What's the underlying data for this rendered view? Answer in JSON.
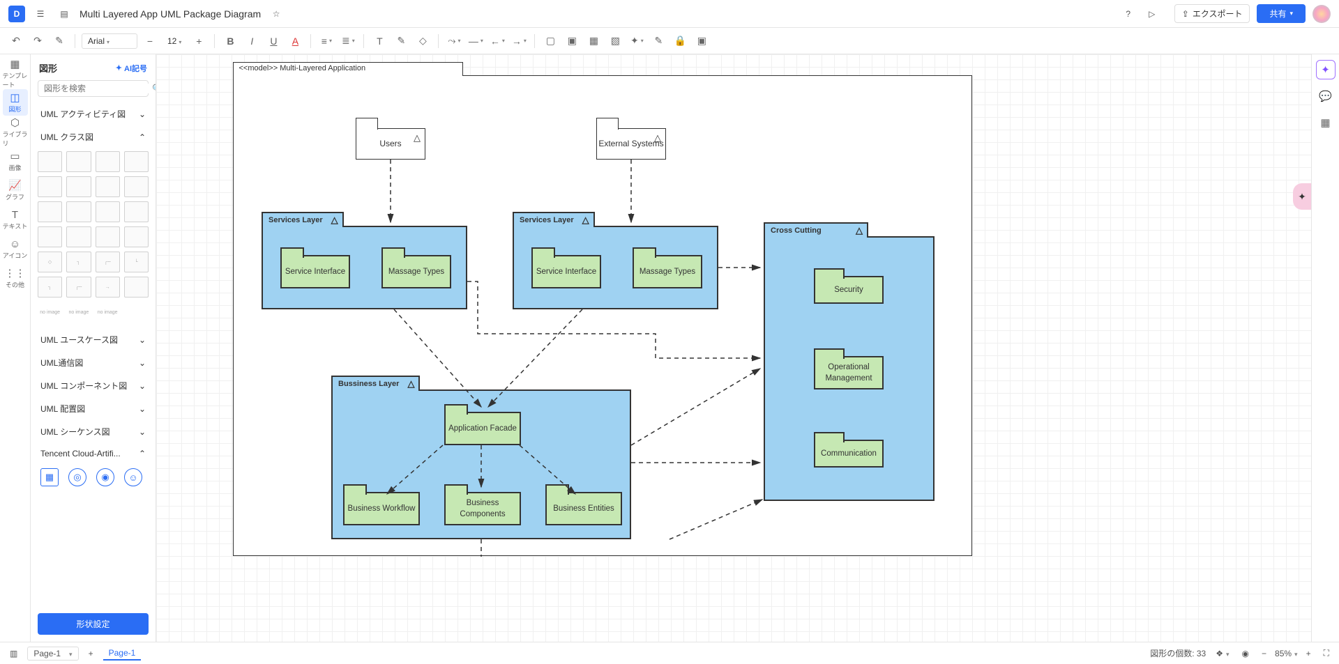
{
  "header": {
    "title": "Multi Layered App UML Package Diagram",
    "export": "エクスポート",
    "share": "共有"
  },
  "toolbar": {
    "font": "Arial",
    "fontSize": "12"
  },
  "leftRail": {
    "template": "テンプレート",
    "shapes": "図形",
    "library": "ライブラリ",
    "image": "画像",
    "graph": "グラフ",
    "text": "テキスト",
    "icon": "アイコン",
    "other": "その他"
  },
  "shapesPanel": {
    "title": "図形",
    "ai": "AI記号",
    "searchPlaceholder": "図形を検索",
    "cat_activity": "UML アクティビティ図",
    "cat_class": "UML クラス図",
    "cat_usecase": "UML ユースケース図",
    "cat_comm": "UML通信図",
    "cat_component": "UML コンポーネント図",
    "cat_deploy": "UML 配置図",
    "cat_sequence": "UML シーケンス図",
    "cat_tencent": "Tencent Cloud-Artifi...",
    "noImage": "no image",
    "shapeSettings": "形状設定"
  },
  "diagram": {
    "modelLabel": "<<model>> Multi-Layered Application",
    "users": "Users",
    "external": "External Systems",
    "servicesLayer": "Services Layer",
    "serviceInterface": "Service Interface",
    "massageTypes": "Massage Types",
    "businessLayer": "Bussiness Layer",
    "appFacade": "Application Facade",
    "bizWorkflow": "Business Workflow",
    "bizComponents": "Business Components",
    "bizEntities": "Business Entities",
    "crossCutting": "Cross Cutting",
    "security": "Security",
    "opManagement": "Operational Management",
    "communication": "Communication"
  },
  "bottom": {
    "page": "Page-1",
    "pageTab": "Page-1",
    "shapeCount": "図形の個数: 33",
    "zoom": "85%"
  }
}
